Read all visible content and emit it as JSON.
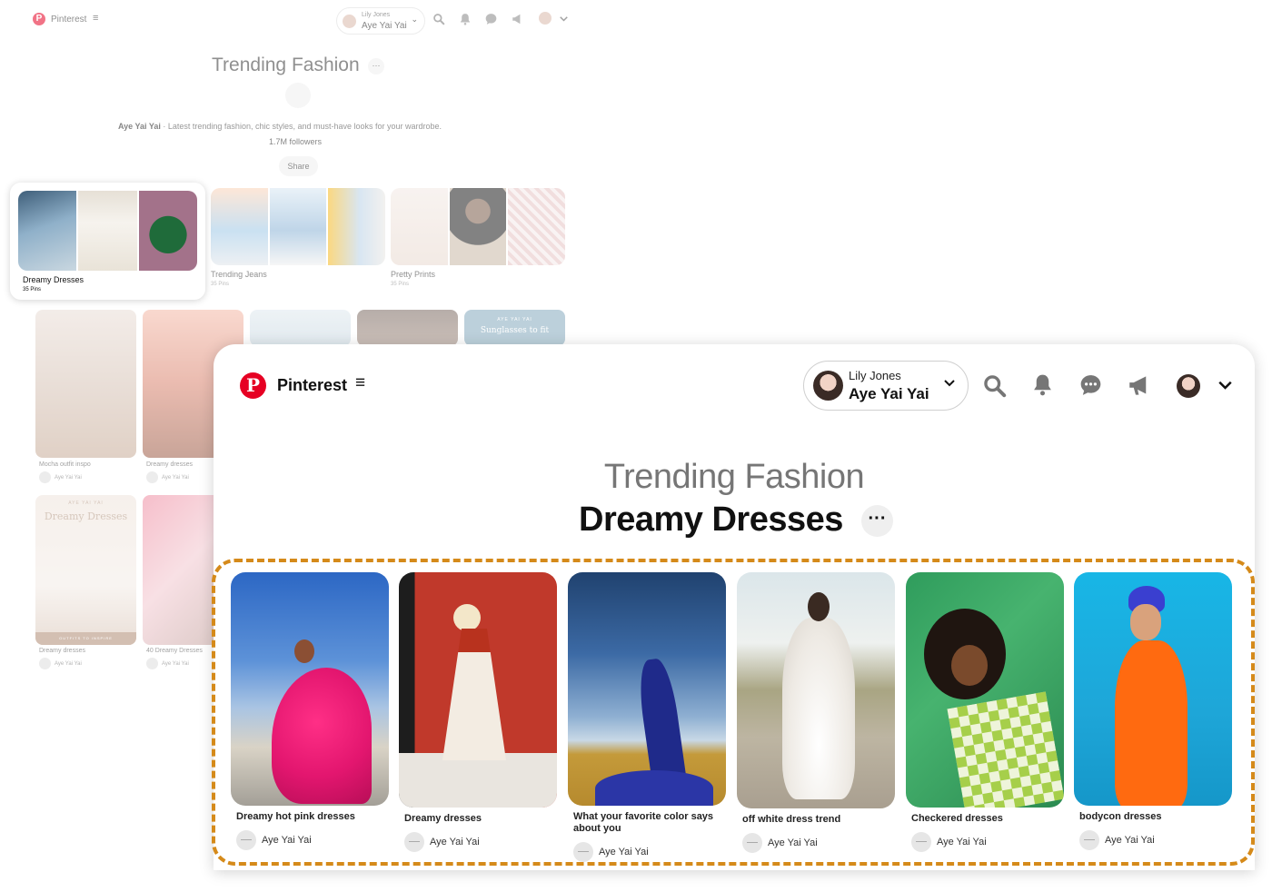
{
  "background_page": {
    "brand": "Pinterest",
    "account": {
      "switch_label": "Lily Jones",
      "name": "Aye Yai Yai"
    },
    "board_group_title": "Trending Fashion",
    "profile_name": "Aye Yai Yai",
    "description": " · Latest trending fashion, chic styles, and must-have looks for your wardrobe.",
    "followers": "1.7M followers",
    "share_label": "Share",
    "boards": [
      {
        "title": "Dreamy Dresses",
        "pins": "35 Pins"
      },
      {
        "title": "Trending Jeans",
        "pins": "35 Pins"
      },
      {
        "title": "Pretty Prints",
        "pins": "35 Pins"
      }
    ],
    "pins": [
      {
        "title": "Mocha outfit inspo",
        "user": "Aye Yai Yai"
      },
      {
        "title": "Dreamy dresses",
        "user": "Aye Yai Yai"
      },
      {
        "title": "Dreamy dresses",
        "user": "Aye Yai Yai"
      },
      {
        "title": "40 Dreamy Dresses",
        "user": "Aye Yai Yai"
      }
    ],
    "overlay_texts": {
      "sunglasses": "Sunglasses to fit",
      "aye_yai_yai": "AYE YAI YAI",
      "dreamy_dresses": "Dreamy Dresses",
      "outfits": "OUTFITS TO INSPIRE"
    }
  },
  "foreground": {
    "brand": "Pinterest",
    "account": {
      "switch_label": "Lily Jones",
      "name": "Aye Yai Yai"
    },
    "title": "Trending Fashion",
    "board_name": "Dreamy Dresses",
    "pins": [
      {
        "title": "Dreamy hot pink dresses",
        "user": "Aye Yai Yai"
      },
      {
        "title": "Dreamy dresses",
        "user": "Aye Yai Yai"
      },
      {
        "title": "What your favorite color says about you",
        "user": "Aye Yai Yai"
      },
      {
        "title": "off white dress trend",
        "user": "Aye Yai Yai"
      },
      {
        "title": "Checkered dresses",
        "user": "Aye Yai Yai"
      },
      {
        "title": "bodycon dresses",
        "user": "Aye Yai Yai"
      }
    ]
  },
  "colors": {
    "brand_red": "#e60023",
    "highlight": "#d58a1a"
  },
  "icons": [
    "pinterest-logo-icon",
    "menu-icon",
    "chevron-down-icon",
    "search-icon",
    "bell-icon",
    "chat-icon",
    "megaphone-icon",
    "avatar",
    "more-icon"
  ]
}
